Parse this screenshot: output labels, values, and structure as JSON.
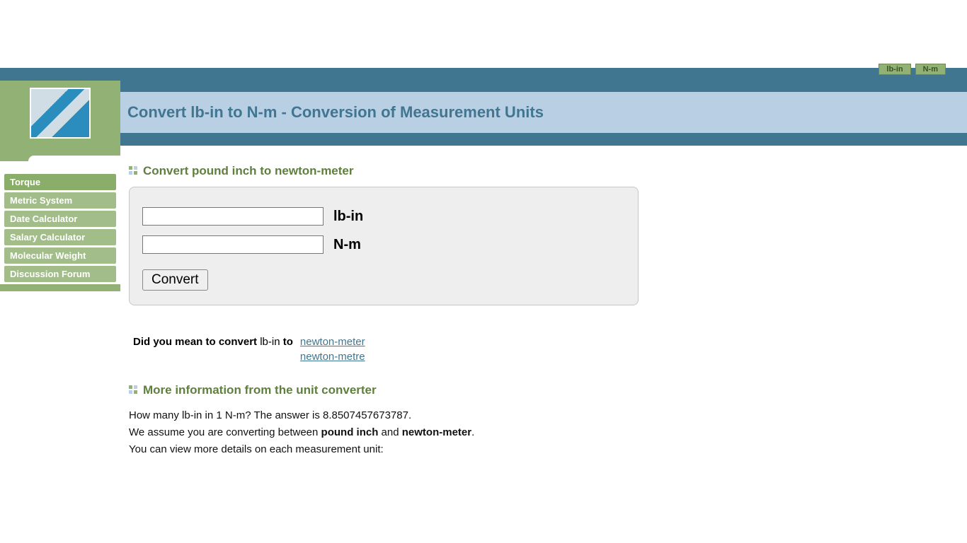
{
  "topTabs": [
    "lb-in",
    "N-m"
  ],
  "pageTitle": "Convert lb-in to N-m - Conversion of Measurement Units",
  "nav": {
    "items": [
      "Torque",
      "Metric System",
      "Date Calculator",
      "Salary Calculator",
      "Molecular Weight",
      "Discussion Forum"
    ]
  },
  "section1": {
    "title": "Convert pound inch to newton-meter",
    "unit1": "lb-in",
    "unit2": "N-m",
    "button": "Convert"
  },
  "suggest": {
    "prefix": "Did you mean to convert",
    "from": "lb-in",
    "to": "to",
    "links": [
      "newton-meter",
      "newton-metre"
    ]
  },
  "section2": {
    "title": "More information from the unit converter",
    "line1a": "How many lb-in in 1 N-m? The answer is 8.8507457673787.",
    "line2a": "We assume you are converting between ",
    "line2b": "pound inch",
    "line2c": " and ",
    "line2d": "newton-meter",
    "line2e": ".",
    "line3": "You can view more details on each measurement unit:"
  }
}
